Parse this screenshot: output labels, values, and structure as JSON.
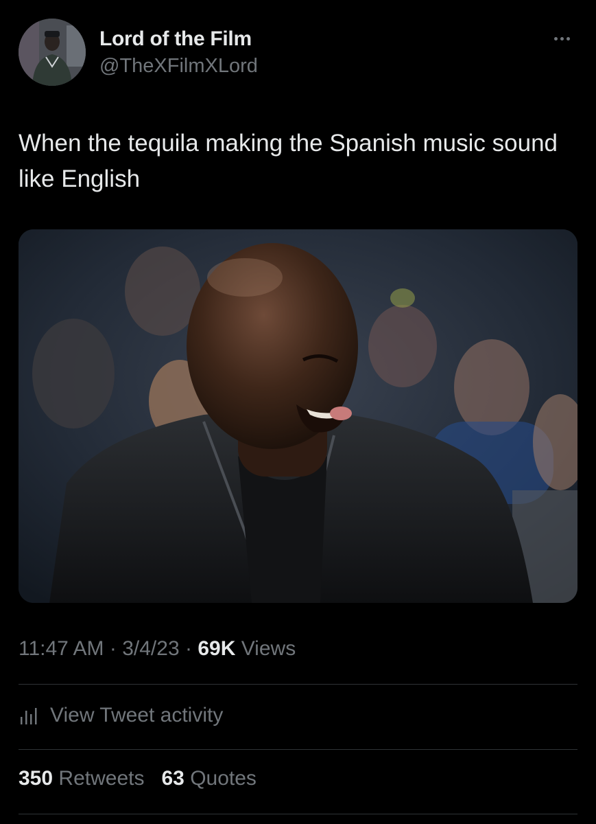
{
  "author": {
    "display_name": "Lord of the Film",
    "handle": "@TheXFilmXLord"
  },
  "tweet": {
    "text": "When the tequila making the Spanish music sound like English"
  },
  "meta": {
    "time": "11:47 AM",
    "separator": "·",
    "date": "3/4/23",
    "views_count": "69K",
    "views_label": "Views"
  },
  "activity": {
    "label": "View Tweet activity"
  },
  "stats": {
    "retweets_count": "350",
    "retweets_label": "Retweets",
    "quotes_count": "63",
    "quotes_label": "Quotes"
  },
  "icons": {
    "more": "more-horizontal-icon",
    "activity": "bar-chart-icon"
  },
  "colors": {
    "background": "#000000",
    "primary_text": "#e7e9ea",
    "secondary_text": "#71767b",
    "divider": "#2f3336"
  }
}
